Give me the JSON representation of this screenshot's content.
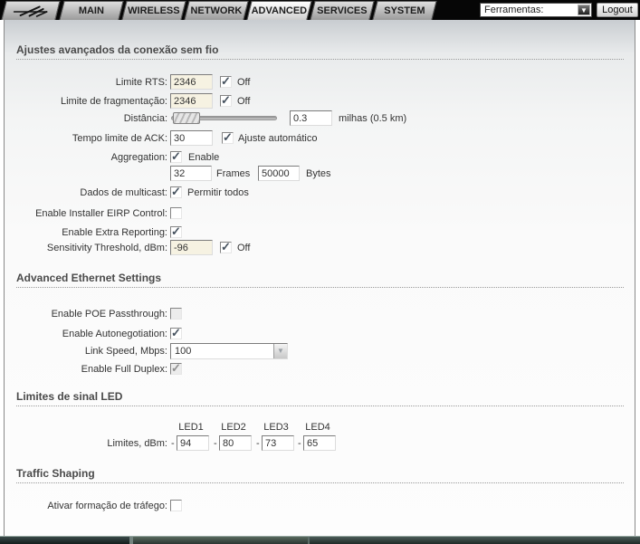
{
  "navbar": {
    "tabs": [
      "MAIN",
      "WIRELESS",
      "NETWORK",
      "ADVANCED",
      "SERVICES",
      "SYSTEM"
    ],
    "active_tab": "ADVANCED",
    "tools_dropdown_label": "Ferramentas:",
    "dropdown_arrow": "▼",
    "logout_button": "Logout"
  },
  "wireless_section": {
    "title": "Ajustes avançados da conexão sem fio",
    "rts": {
      "label": "Limite RTS:",
      "value": "2346",
      "off_label": "Off",
      "off_checked": true,
      "input_disabled": true
    },
    "frag": {
      "label": "Limite de fragmentação:",
      "value": "2346",
      "off_label": "Off",
      "off_checked": true,
      "input_disabled": true
    },
    "distance": {
      "label": "Distância:",
      "value": "0.3",
      "unit": "milhas (0.5 km)"
    },
    "ack": {
      "label": "Tempo limite de ACK:",
      "value": "30",
      "auto_label": "Ajuste automático",
      "auto_checked": true
    },
    "aggregation": {
      "label": "Aggregation:",
      "enable_label": "Enable",
      "enabled": true,
      "frames_value": "32",
      "frames_label": "Frames",
      "bytes_value": "50000",
      "bytes_label": "Bytes"
    },
    "multicast": {
      "label": "Dados de multicast:",
      "allow_label": "Permitir todos",
      "checked": true
    },
    "eirp": {
      "label": "Enable Installer EIRP Control:",
      "checked": false
    },
    "extra_reporting": {
      "label": "Enable Extra Reporting:",
      "checked": true
    },
    "sensitivity": {
      "label": "Sensitivity Threshold, dBm:",
      "value": "-96",
      "off_label": "Off",
      "off_checked": true,
      "input_disabled": true
    }
  },
  "ethernet_section": {
    "title": "Advanced Ethernet Settings",
    "poe": {
      "label": "Enable POE Passthrough:",
      "checked": false,
      "disabled": true
    },
    "autoneg": {
      "label": "Enable Autonegotiation:",
      "checked": true
    },
    "link_speed": {
      "label": "Link Speed, Mbps:",
      "value": "100",
      "disabled": true
    },
    "full_duplex": {
      "label": "Enable Full Duplex:",
      "checked": true,
      "disabled": true
    }
  },
  "led_section": {
    "title": "Limites de sinal LED",
    "columns": [
      "LED1",
      "LED2",
      "LED3",
      "LED4"
    ],
    "label": "Limites, dBm:",
    "minus": "-",
    "values": [
      "94",
      "80",
      "73",
      "65"
    ]
  },
  "traffic_section": {
    "title": "Traffic Shaping",
    "enable": {
      "label": "Ativar formação de tráfego:",
      "checked": false
    }
  }
}
